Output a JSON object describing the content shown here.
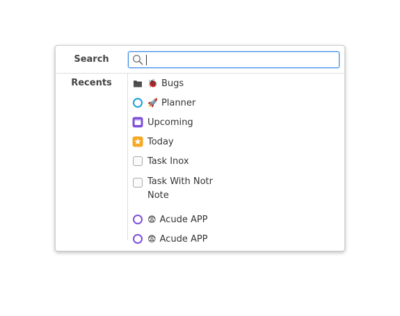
{
  "search": {
    "label": "Search",
    "value": "",
    "placeholder": ""
  },
  "recents": {
    "label": "Recents",
    "items": [
      {
        "label": "Bugs",
        "icon": "folder-icon",
        "emoji": "🐞"
      },
      {
        "label": "Planner",
        "icon": "circle-icon",
        "emoji": "🚀"
      },
      {
        "label": "Upcoming",
        "icon": "calendar-icon",
        "emoji": ""
      },
      {
        "label": "Today",
        "icon": "star-icon",
        "emoji": ""
      },
      {
        "label": "Task Inox",
        "icon": "checkbox-icon",
        "emoji": ""
      },
      {
        "label": "Task With Notr",
        "label_line2": "Note",
        "icon": "checkbox-icon",
        "emoji": ""
      },
      {
        "label": "Acude APP",
        "icon": "circle-icon",
        "emoji": "😨"
      },
      {
        "label": "Acude APP",
        "icon": "circle-icon",
        "emoji": "😨"
      }
    ]
  },
  "colors": {
    "accent": "#3689e6",
    "project_circle": "#17a0d4",
    "project_circle_purple": "#7e4fd9",
    "upcoming": "#7e4fd9",
    "today": "#f9a825"
  }
}
